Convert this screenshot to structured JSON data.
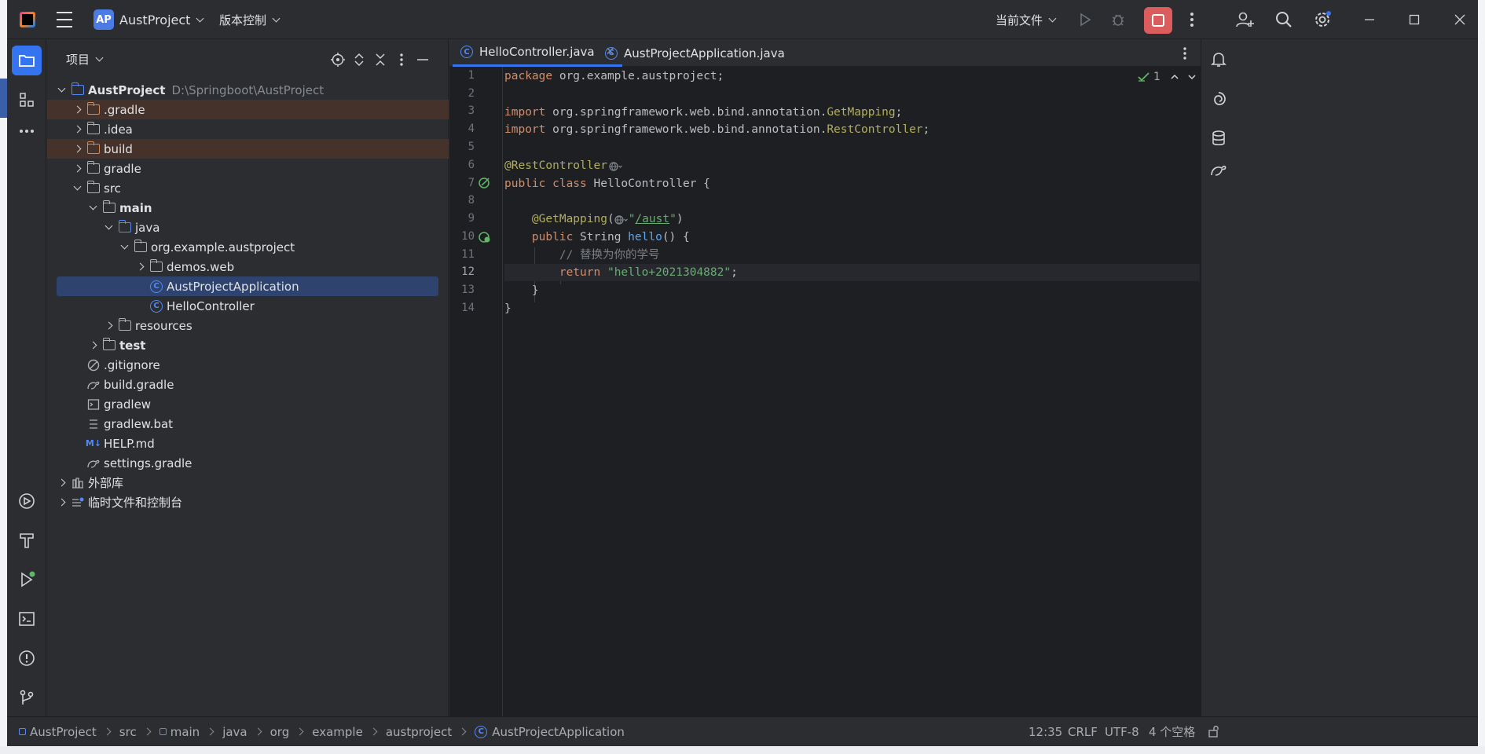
{
  "titlebar": {
    "project_badge": "AP",
    "project_name": "AustProject",
    "vcs_label": "版本控制",
    "current_file_label": "当前文件"
  },
  "project_panel": {
    "title": "项目",
    "tree": [
      {
        "label": "AustProject",
        "path": "D:\\Springboot\\AustProject"
      },
      {
        "label": ".gradle"
      },
      {
        "label": ".idea"
      },
      {
        "label": "build"
      },
      {
        "label": "gradle"
      },
      {
        "label": "src"
      },
      {
        "label": "main"
      },
      {
        "label": "java"
      },
      {
        "label": "org.example.austproject"
      },
      {
        "label": "demos.web"
      },
      {
        "label": "AustProjectApplication"
      },
      {
        "label": "HelloController"
      },
      {
        "label": "resources"
      },
      {
        "label": "test"
      },
      {
        "label": ".gitignore"
      },
      {
        "label": "build.gradle"
      },
      {
        "label": "gradlew"
      },
      {
        "label": "gradlew.bat"
      },
      {
        "label": "HELP.md"
      },
      {
        "label": "settings.gradle"
      },
      {
        "label": "外部库"
      },
      {
        "label": "临时文件和控制台"
      }
    ]
  },
  "editor": {
    "tabs": [
      {
        "label": "HelloController.java"
      },
      {
        "label": "AustProjectApplication.java"
      }
    ],
    "inspection_count": "1",
    "code": {
      "l1_kw": "package",
      "l1_rest": " org.example.austproject;",
      "l3_kw": "import",
      "l3_pkg": " org.springframework.web.bind.annotation.",
      "l3_cls": "GetMapping",
      "l3_end": ";",
      "l4_kw": "import",
      "l4_pkg": " org.springframework.web.bind.annotation.",
      "l4_cls": "RestController",
      "l4_end": ";",
      "l6_ann": "@RestController",
      "l7_kw": "public class",
      "l7_rest": " HelloController {",
      "l9_ann": "@GetMapping",
      "l9_open": "(",
      "l9_q1": "\"",
      "l9_url": "/aust",
      "l9_q2": "\"",
      "l9_close": ")",
      "l10_kw": "public",
      "l10_type": " String ",
      "l10_fn": "hello",
      "l10_rest": "() {",
      "l11_cmt": "// 替换为你的学号",
      "l12_kw": "return",
      "l12_str": "\"hello+2021304882\"",
      "l12_end": ";",
      "l13": "}",
      "l14": "}"
    },
    "line_numbers": [
      "1",
      "2",
      "3",
      "4",
      "5",
      "6",
      "7",
      "8",
      "9",
      "10",
      "11",
      "12",
      "13",
      "14"
    ]
  },
  "statusbar": {
    "breadcrumbs": [
      "AustProject",
      "src",
      "main",
      "java",
      "org",
      "example",
      "austproject",
      "AustProjectApplication"
    ],
    "position": "12:35",
    "line_sep": "CRLF",
    "encoding": "UTF-8",
    "indent": "4 个空格"
  },
  "colors": {
    "accent": "#3574f0",
    "stop": "#db5c5c",
    "keyword": "#cf8e6d",
    "annotation": "#b3ae60",
    "string": "#6aab73"
  }
}
